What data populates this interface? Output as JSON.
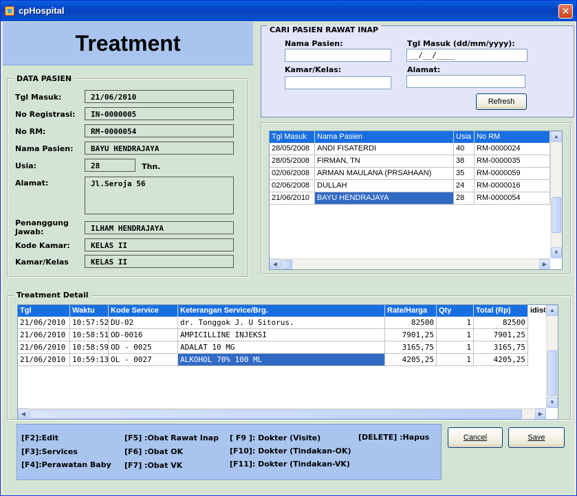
{
  "window": {
    "title": "cpHospital",
    "close_glyph": "✕"
  },
  "header": {
    "title": "Treatment"
  },
  "data_pasien": {
    "legend": "DATA PASIEN",
    "tgl_masuk_label": "Tgl Masuk:",
    "tgl_masuk": "21/06/2010",
    "no_registrasi_label": "No Registrasi:",
    "no_registrasi": "IN-0000005",
    "no_rm_label": "No RM:",
    "no_rm": "RM-0000054",
    "nama_pasien_label": "Nama Pasien:",
    "nama_pasien": "BAYU HENDRAJAYA",
    "usia_label": "Usia:",
    "usia": "28",
    "usia_unit": "Thn.",
    "alamat_label": "Alamat:",
    "alamat": "Jl.Seroja 56",
    "penanggung_label_1": "Penanggung",
    "penanggung_label_2": "Jawab:",
    "penanggung": "ILHAM HENDRAJAYA",
    "kode_kamar_label": "Kode Kamar:",
    "kode_kamar": "KELAS  II",
    "kamar_kelas_label": "Kamar/Kelas",
    "kamar_kelas": "KELAS II"
  },
  "search": {
    "legend": "CARI PASIEN RAWAT INAP",
    "nama_label": "Nama Pasien:",
    "nama_value": "",
    "tgl_label": "Tgl Masuk (dd/mm/yyyy):",
    "tgl_value": "__/__/____",
    "kamar_label": "Kamar/Kelas:",
    "kamar_value": "",
    "alamat_label": "Alamat:",
    "alamat_value": "",
    "refresh_label": "Refresh"
  },
  "patient_grid": {
    "headers": [
      "Tgl Masuk",
      "Nama Pasien",
      "Usia",
      "No RM"
    ],
    "rows": [
      [
        "28/05/2008",
        "ANDI FISATERDI",
        "40",
        "RM-0000024"
      ],
      [
        "28/05/2008",
        "FIRMAN, TN",
        "38",
        "RM-0000035"
      ],
      [
        "02/06/2008",
        "ARMAN MAULANA (PRSAHAAN)",
        "35",
        "RM-0000059"
      ],
      [
        "02/06/2008",
        "DULLAH",
        "24",
        "RM-0000016"
      ],
      [
        "21/06/2010",
        "BAYU HENDRAJAYA",
        "28",
        "RM-0000054"
      ]
    ],
    "selected_row": 4
  },
  "treatment_detail": {
    "legend": "Treatment Detail",
    "headers": [
      "Tgl",
      "Waktu",
      "Kode Service",
      "Keterangan Service/Brg.",
      "Rate/Harga",
      "Qty",
      "Total (Rp)",
      "idisC"
    ],
    "rows": [
      [
        "21/06/2010",
        "10:57:52",
        "DU-02",
        "dr. Tonggok J. U Sitorus.",
        "82500",
        "1",
        "82500"
      ],
      [
        "21/06/2010",
        "10:58:51",
        "OD-0016",
        "AMPICILLINE INJEKSI",
        "7901,25",
        "1",
        "7901,25"
      ],
      [
        "21/06/2010",
        "10:58:59",
        "OD - 0025",
        "ADALAT 10 MG",
        "3165,75",
        "1",
        "3165,75"
      ],
      [
        "21/06/2010",
        "10:59:13",
        "OL - 0027",
        "ALKOHOL 70% 100 ML",
        "4205,25",
        "1",
        "4205,25"
      ]
    ],
    "selected_row": 3
  },
  "shortcuts": {
    "f2": "[F2]:Edit",
    "f3": "[F3]:Services",
    "f4": "[F4]:Perawatan Baby",
    "f5": "[F5] :Obat Rawat Inap",
    "f6": "[F6] :Obat OK",
    "f7": "[F7] :Obat VK",
    "f9": "[ F9 ]: Dokter (Visite)",
    "f10": "[F10]: Dokter (Tindakan-OK)",
    "f11": "[F11]: Dokter (Tindakan-VK)",
    "delete": "[DELETE] :Hapus"
  },
  "buttons": {
    "cancel": "Cancel",
    "save": "Save"
  },
  "scroll": {
    "up": "▲",
    "down": "▼",
    "left": "◀",
    "right": "▶"
  }
}
